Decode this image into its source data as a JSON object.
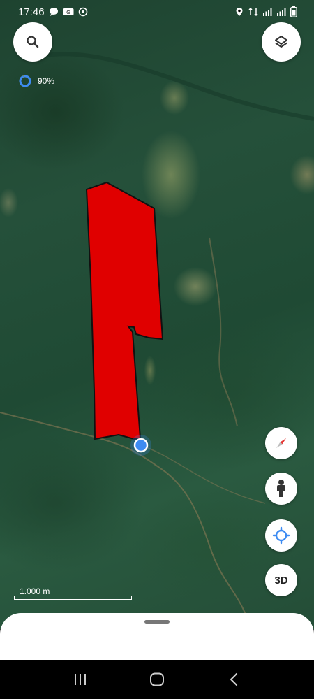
{
  "status_bar": {
    "time": "17:46",
    "left_icons": [
      "message-icon",
      "data-saver-icon",
      "location-sharing-icon"
    ],
    "right_icons": [
      "location-icon",
      "sync-icon",
      "signal-icon",
      "signal-icon",
      "battery-icon"
    ]
  },
  "map": {
    "search_icon": "search-icon",
    "layers_icon": "layers-icon",
    "polygon_fill": "#e00000",
    "location_dot_color": "#3d8bf2"
  },
  "progress": {
    "value": 0.9,
    "label": "90%"
  },
  "scale": {
    "label": "1.000 m"
  },
  "controls": {
    "compass_icon": "compass-icon",
    "street_view_icon": "pegman-icon",
    "my_location_icon": "my-location-icon",
    "three_d_label": "3D"
  },
  "colors": {
    "accent": "#3d8bf2",
    "compass_red": "#e53935"
  },
  "nav": {
    "recents_icon": "recents-icon",
    "home_icon": "home-icon",
    "back_icon": "back-icon"
  }
}
